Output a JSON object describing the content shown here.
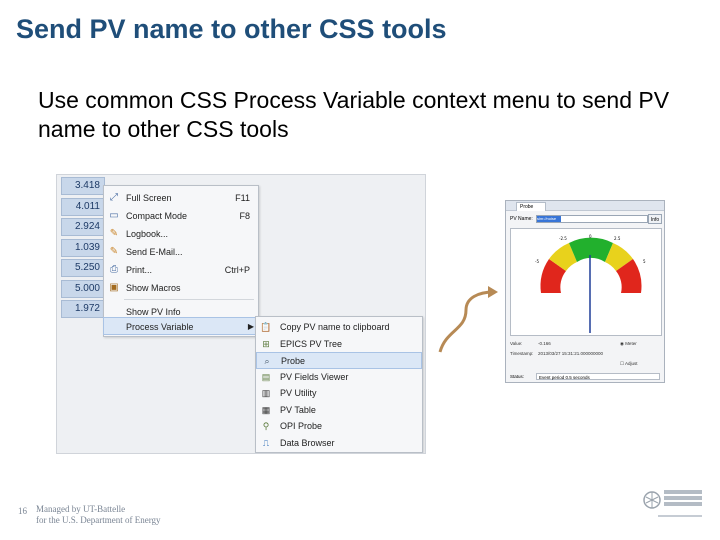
{
  "slide": {
    "title": "Send PV name to other CSS tools",
    "subtitle": "Use common CSS Process Variable context menu to send PV name to other CSS tools",
    "page_number": "16",
    "footer_line1": "Managed by UT-Battelle",
    "footer_line2": "for the U.S. Department of Energy"
  },
  "values_column": [
    "3.418",
    "4.011",
    "2.924",
    "1.039",
    "5.250",
    "5.000",
    "1.972"
  ],
  "context_menu": {
    "items": [
      {
        "label": "Full Screen",
        "shortcut": "F11",
        "icon": "full-screen-icon"
      },
      {
        "label": "Compact Mode",
        "shortcut": "F8",
        "icon": "compact-mode-icon"
      },
      {
        "label": "Logbook...",
        "shortcut": "",
        "icon": "logbook-pencil-icon"
      },
      {
        "label": "Send E-Mail...",
        "shortcut": "",
        "icon": "email-pencil-icon"
      },
      {
        "label": "Print...",
        "shortcut": "Ctrl+P",
        "icon": "printer-icon"
      },
      {
        "label": "Show Macros",
        "shortcut": "",
        "icon": "macros-icon"
      },
      {
        "label": "Show PV Info",
        "shortcut": "",
        "icon": ""
      },
      {
        "label": "Process Variable",
        "shortcut": "",
        "icon": "",
        "highlighted": true
      }
    ]
  },
  "submenu": {
    "items": [
      {
        "label": "Copy PV name to clipboard",
        "icon": "clipboard-icon"
      },
      {
        "label": "EPICS PV Tree",
        "icon": "pv-tree-icon"
      },
      {
        "label": "Probe",
        "icon": "magnifier-icon",
        "highlighted": true
      },
      {
        "label": "PV Fields Viewer",
        "icon": "pv-fields-icon"
      },
      {
        "label": "PV Utility",
        "icon": "pv-utility-icon"
      },
      {
        "label": "PV Table",
        "icon": "pv-table-icon"
      },
      {
        "label": "OPI Probe",
        "icon": "opi-probe-icon"
      },
      {
        "label": "Data Browser",
        "icon": "data-browser-icon"
      }
    ]
  },
  "probe": {
    "tab_label": "Probe",
    "pv_name_label": "PV Name:",
    "pv_name_value": "sim://noise",
    "info_button": "Info",
    "value_label": "Value:",
    "value": "-0.166",
    "timestamp_label": "Timestamp:",
    "timestamp": "2013/03/27 15:31:21.000000000",
    "meter_label": "Meter",
    "adjust_label": "Adjust",
    "status_label": "Status:",
    "status": "Event period 0.5 seconds",
    "gauge_ticks": [
      "0",
      "2.5",
      "-2.5",
      "-5",
      "5"
    ]
  },
  "colors": {
    "title": "#1f4e79",
    "gauge_red": "#e0261c",
    "gauge_yellow": "#e8d21c",
    "gauge_green": "#22b02d",
    "needle": "#1f3d99",
    "curve_arrow": "#b78a55"
  }
}
